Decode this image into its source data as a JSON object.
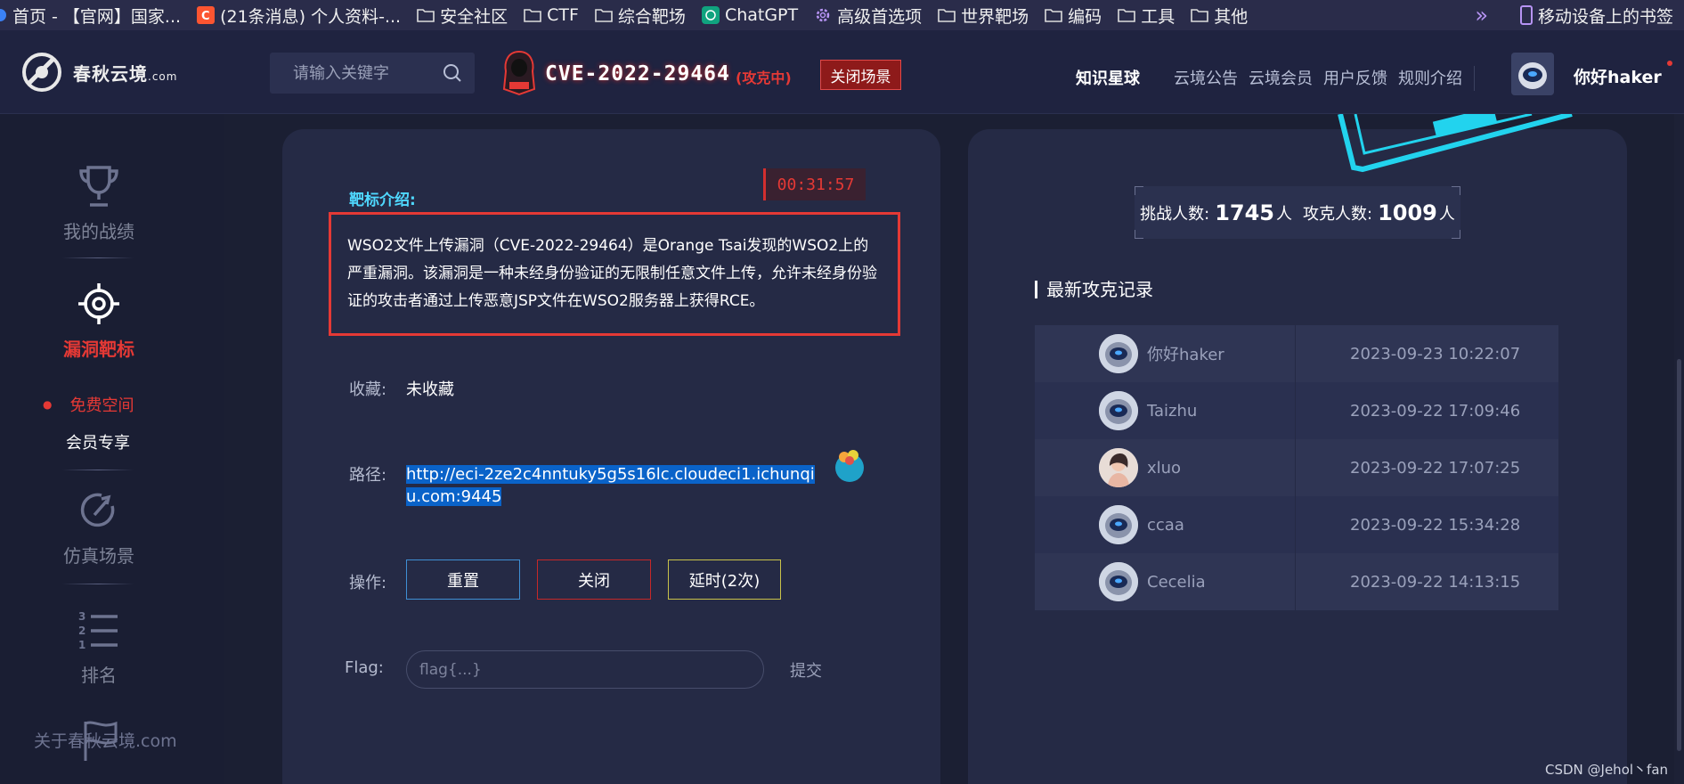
{
  "bookmarks": {
    "items": [
      "首页 - 【官网】国家...",
      "(21条消息) 个人资料-...",
      "安全社区",
      "CTF",
      "综合靶场",
      "ChatGPT",
      "高级首选项",
      "世界靶场",
      "编码",
      "工具",
      "其他"
    ],
    "more": "»",
    "mobile": "移动设备上的书签"
  },
  "header": {
    "logo_text": "春秋云境",
    "logo_suffix": ".com",
    "search_placeholder": "请输入关键字",
    "cve_title": "CVE-2022-29464",
    "cve_status": "(攻克中)",
    "close_scene": "关闭场景",
    "nav": [
      "知识星球",
      "云境公告",
      "云境会员",
      "用户反馈",
      "规则介绍"
    ],
    "username": "你好haker"
  },
  "sidebar": {
    "items": [
      "我的战绩",
      "漏洞靶标",
      "仿真场景",
      "排名"
    ],
    "subitems": [
      "免费空间",
      "会员专享"
    ],
    "about": "关于春秋云境.com"
  },
  "target": {
    "timer": "00:31:57",
    "intro_title": "靶标介绍:",
    "intro_text": "WSO2文件上传漏洞（CVE-2022-29464）是Orange Tsai发现的WSO2上的严重漏洞。该漏洞是一种未经身份验证的无限制任意文件上传，允许未经身份验证的攻击者通过上传恶意JSP文件在WSO2服务器上获得RCE。",
    "favorite_label": "收藏:",
    "favorite_value": "未收藏",
    "path_label": "路径:",
    "path_value": "http://eci-2ze2c4nntuky5g5s16lc.cloudeci1.ichunqiu.com:9445",
    "ops_label": "操作:",
    "btn_reset": "重置",
    "btn_close": "关闭",
    "btn_extend": "延时(2次)",
    "flag_label": "Flag:",
    "flag_placeholder": "flag{...}",
    "submit": "提交"
  },
  "stats": {
    "challengers_label": "挑战人数:",
    "challengers": "1745",
    "challengers_unit": "人",
    "solvers_label": "攻克人数:",
    "solvers": "1009",
    "solvers_unit": "人"
  },
  "records": {
    "title": "最新攻克记录",
    "rows": [
      {
        "name": "你好haker",
        "time": "2023-09-23 10:22:07"
      },
      {
        "name": "Taizhu",
        "time": "2023-09-22 17:09:46"
      },
      {
        "name": "xluo",
        "time": "2023-09-22 17:07:25"
      },
      {
        "name": "ccaa",
        "time": "2023-09-22 15:34:28"
      },
      {
        "name": "Cecelia",
        "time": "2023-09-22 14:13:15"
      }
    ]
  },
  "watermark": "CSDN @Jehol丶fan",
  "colors": {
    "accent_red": "#e53935",
    "accent_cyan": "#4fd8ff",
    "panel": "#252a45",
    "background": "#1b1f33"
  }
}
